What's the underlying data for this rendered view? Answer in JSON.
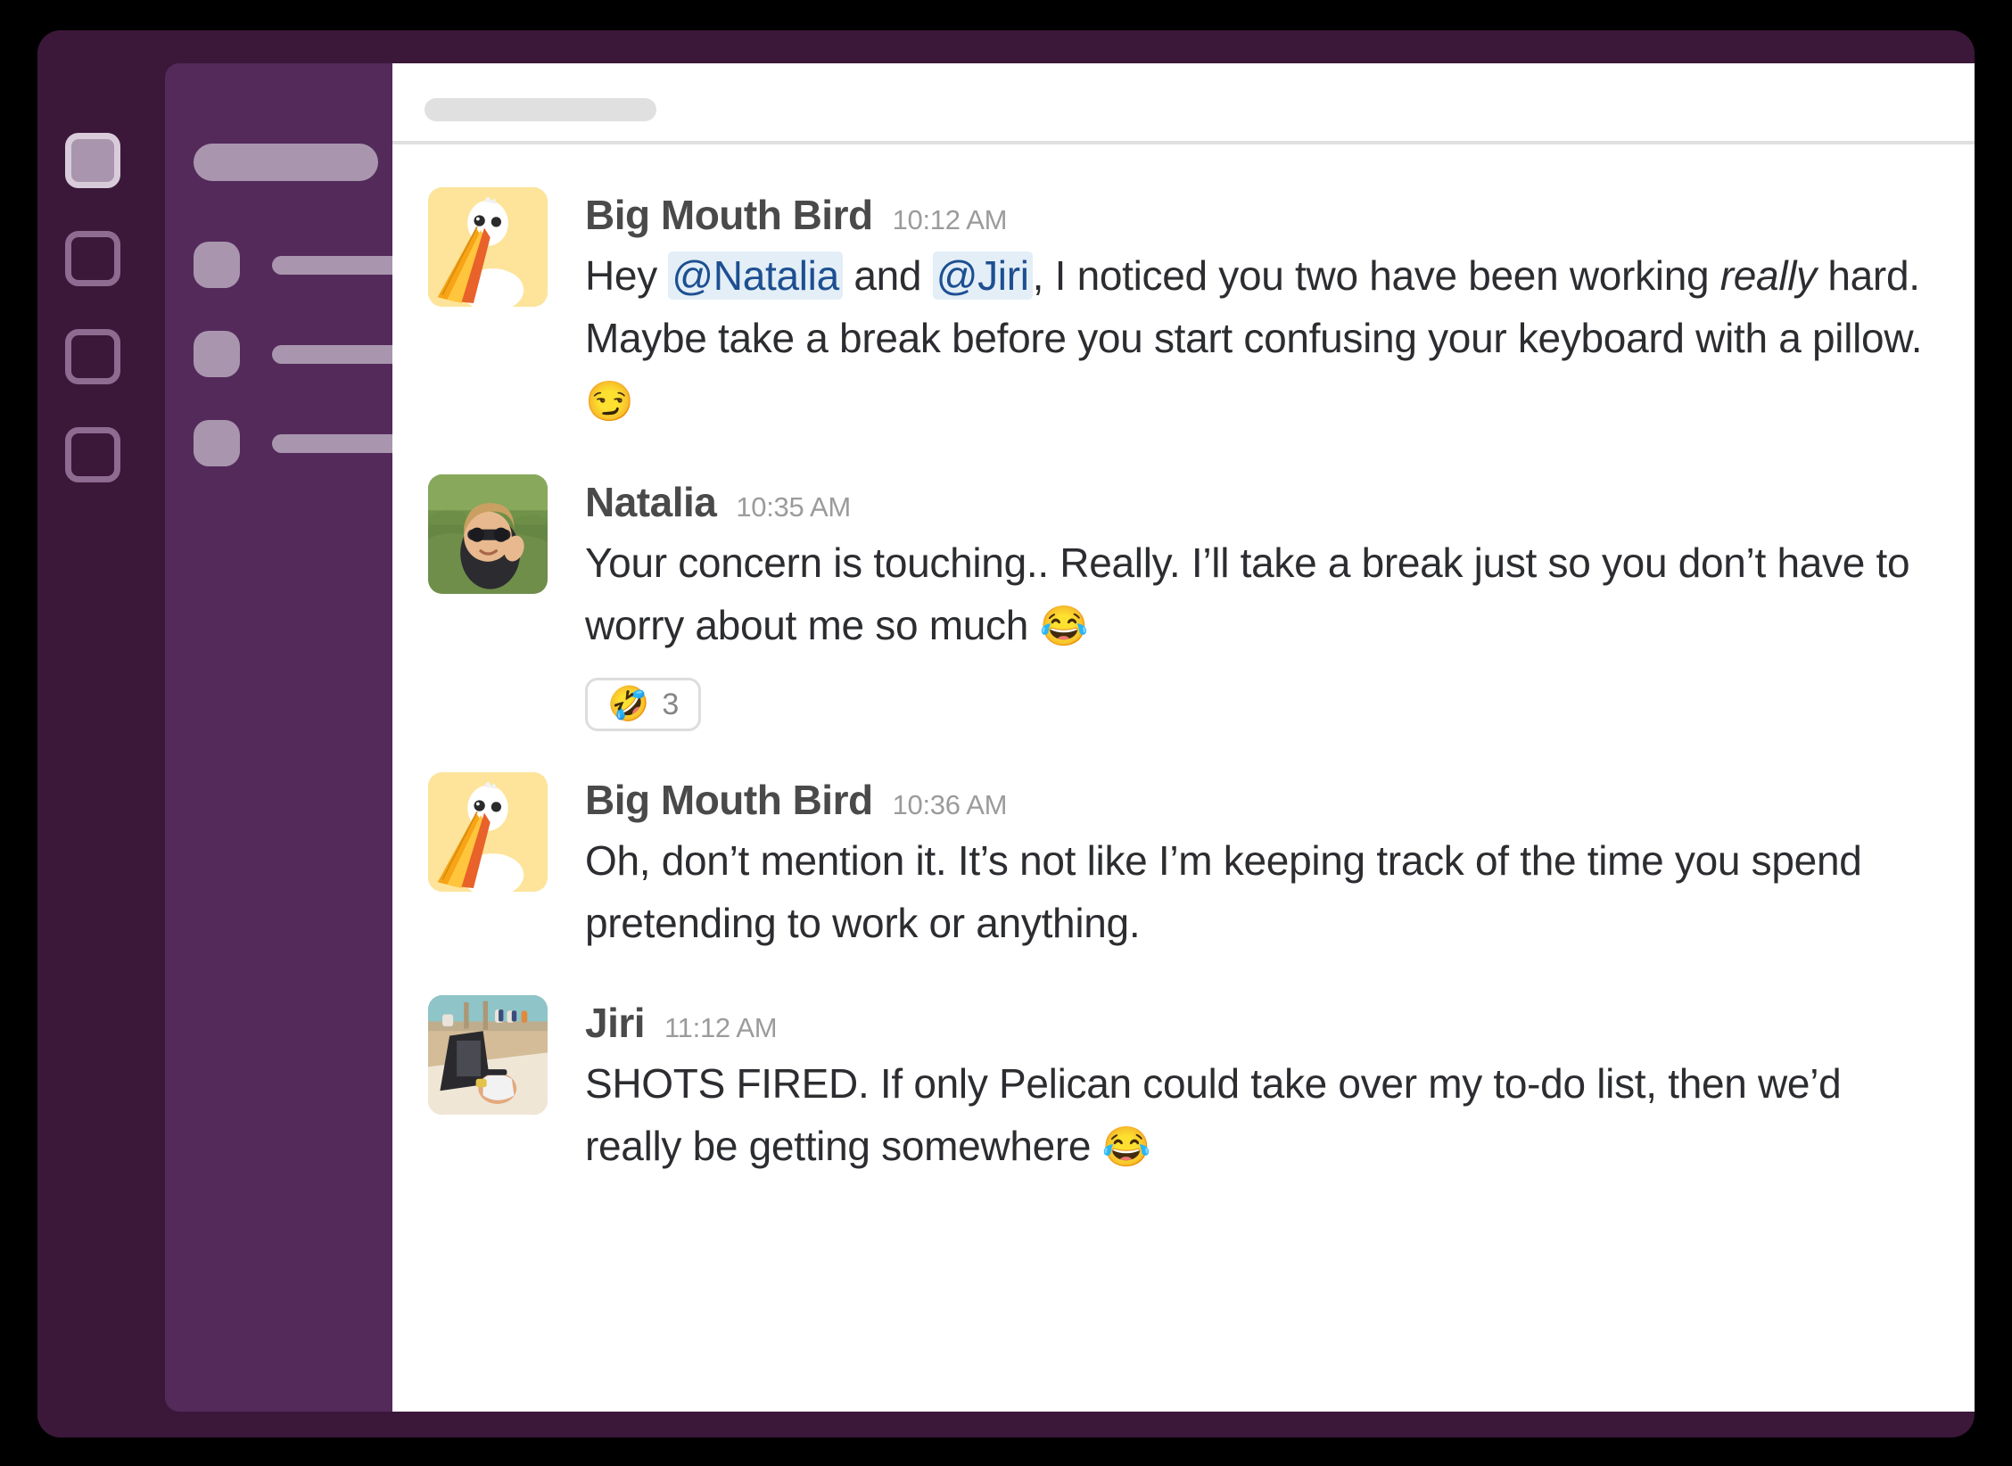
{
  "window": {
    "background_color": "#3B1839",
    "sidebar_color": "#542A5B",
    "accent_mention_color": "#1D4F91",
    "mention_background_color": "#E3EEF7"
  },
  "icon_rail": {
    "items": [
      {
        "name": "rail-icon-1",
        "active": true
      },
      {
        "name": "rail-icon-2",
        "active": false
      },
      {
        "name": "rail-icon-3",
        "active": false
      },
      {
        "name": "rail-icon-4",
        "active": false
      }
    ]
  },
  "sidebar": {
    "title_placeholder": "",
    "channels": [
      {
        "label": ""
      },
      {
        "label": ""
      },
      {
        "label": ""
      }
    ]
  },
  "header": {
    "search_placeholder": ""
  },
  "messages": [
    {
      "author": "Big Mouth Bird",
      "time": "10:12 AM",
      "avatar": "pelican-avatar",
      "text_prefix": "Hey ",
      "mention_1": "@Natalia",
      "text_mid": " and ",
      "mention_2": "@Jiri",
      "text_after": ", I noticed you two have been working ",
      "italic": "really",
      "text_end": " hard. Maybe take a break before you start confusing your keyboard with a pillow. ",
      "trailing_emoji": "😏",
      "reactions": []
    },
    {
      "author": "Natalia",
      "time": "10:35 AM",
      "avatar": "natalia-avatar",
      "text": "Your concern is touching.. Really. I’ll take a break just so you don’t have to worry about me so much ",
      "trailing_emoji": "😂",
      "reactions": [
        {
          "emoji": "🤣",
          "count": "3"
        }
      ]
    },
    {
      "author": "Big Mouth Bird",
      "time": "10:36 AM",
      "avatar": "pelican-avatar",
      "text": "Oh, don’t mention it. It’s not like I’m keeping track of the time you spend pretending to work or anything.",
      "trailing_emoji": "",
      "reactions": []
    },
    {
      "author": "Jiri",
      "time": "11:12 AM",
      "avatar": "jiri-avatar",
      "text": "SHOTS FIRED. If only Pelican could take over my to-do list, then we’d really be getting somewhere ",
      "trailing_emoji": "😂",
      "reactions": []
    }
  ]
}
